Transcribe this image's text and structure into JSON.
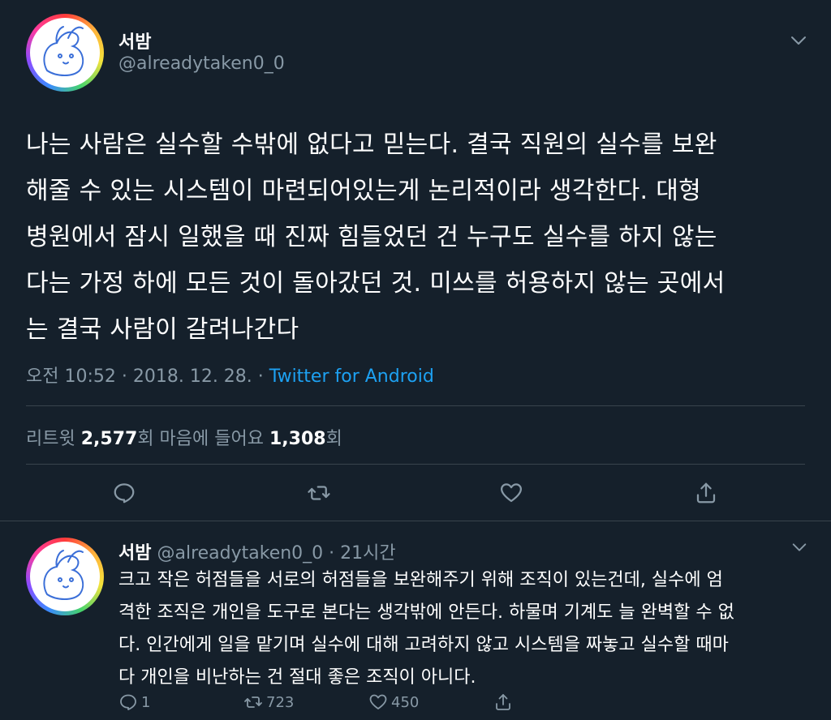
{
  "main_tweet": {
    "author_name": "서밤",
    "author_handle": "@alreadytaken0_0",
    "text_lines": [
      "나는 사람은 실수할 수밖에 없다고 믿는다. 결국 직원의 실수를 보완",
      "해줄 수 있는 시스템이 마련되어있는게 논리적이라 생각한다. 대형",
      "병원에서 잠시 일했을 때 진짜 힘들었던 건 누구도 실수를 하지 않는",
      "다는 가정 하에 모든 것이 돌아갔던 것. 미쓰를 허용하지 않는 곳에서",
      "는 결국 사람이 갈려나간다"
    ],
    "timestamp": "오전 10:52 · 2018. 12. 28. · ",
    "source": "Twitter for Android",
    "stats": {
      "retweet_label": "리트윗 ",
      "retweet_count": "2,577",
      "retweet_unit": "회  마음에 들어요 ",
      "like_count": "1,308",
      "like_unit": "회"
    }
  },
  "reply_tweet": {
    "author_name": "서밤",
    "author_handle": " @alreadytaken0_0",
    "time": " · 21시간",
    "text_lines": [
      "크고 작은 허점들을 서로의 허점들을 보완해주기 위해 조직이 있는건데, 실수에 엄",
      "격한 조직은 개인을 도구로 본다는 생각밖에 안든다. 하물며 기계도 늘 완벽할 수 없",
      "다. 인간에게 일을 맡기며 실수에 대해 고려하지 않고 시스템을 짜놓고 실수할 때마",
      "다 개인을 비난하는 건 절대 좋은 조직이 아니다."
    ],
    "reply_count": "1",
    "retweet_count": "723",
    "like_count": "450"
  },
  "colors": {
    "background": "#15202b",
    "text": "#ffffff",
    "secondary": "#8899a6",
    "link": "#1da1f2",
    "divider": "#38444d"
  },
  "icons": [
    "chevron-down-icon",
    "reply-icon",
    "retweet-icon",
    "like-icon",
    "share-icon"
  ]
}
